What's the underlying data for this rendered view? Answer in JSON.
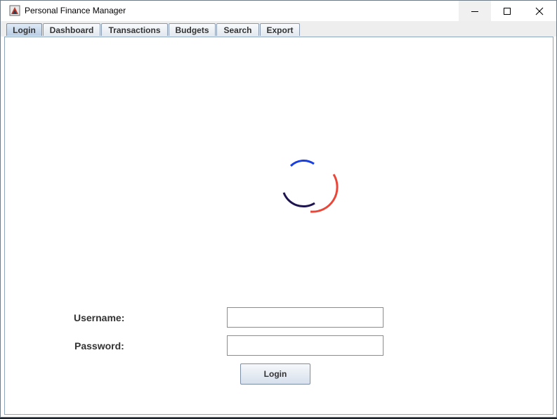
{
  "window": {
    "title": "Personal Finance Manager"
  },
  "tabs": [
    {
      "label": "Login",
      "active": true
    },
    {
      "label": "Dashboard",
      "active": false
    },
    {
      "label": "Transactions",
      "active": false
    },
    {
      "label": "Budgets",
      "active": false
    },
    {
      "label": "Search",
      "active": false
    },
    {
      "label": "Export",
      "active": false
    }
  ],
  "login": {
    "username_label": "Username:",
    "username_value": "",
    "password_label": "Password:",
    "password_value": "",
    "button_label": "Login"
  },
  "spinner": {
    "icon": "loading-spinner-icon",
    "colors": [
      "#1a3fe0",
      "#e8473a",
      "#1e1450"
    ]
  },
  "colors": {
    "tab_active": "#b9cde3",
    "content_border": "#8fa6bf"
  }
}
